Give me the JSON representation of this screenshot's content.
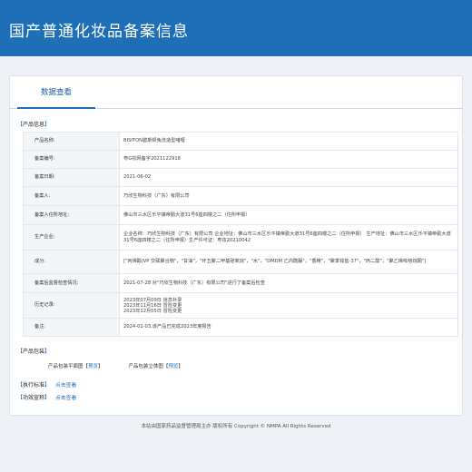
{
  "header": {
    "title": "国产普通化妆品备案信息"
  },
  "tabs": [
    {
      "label": "数据查看"
    }
  ],
  "product_info": {
    "section_title": "产品信息",
    "rows": [
      {
        "label": "产品名称:",
        "value": "BISITON碧斯顿兔洗造型啫喱"
      },
      {
        "label": "备案编号:",
        "value": "粤G妆网备字2021122918"
      },
      {
        "label": "备案日期:",
        "value": "2021-06-02"
      },
      {
        "label": "备案人:",
        "value": "巧欣生物科技（广东）有限公司"
      },
      {
        "label": "备案人住所地址:",
        "value": "佛山市三水区乐平镇帝勤大道31号6座四楼之二（住所申报）"
      },
      {
        "label": "生产企业:",
        "value": "企业名称：巧欣生物科技（广东）有限公司 企业地址：佛山市三水区乐平镇帝勤大道31号6座四楼之二（住所申报） 生产地址：佛山市三水区乐平镇帝勤大道31号6座四楼之二（住所申报）生产许可证：粤妆20210042"
      },
      {
        "label": "成分:",
        "value": "[\"丙烯酸/VP 交联聚合物\"，\"甘油\"，\"环五聚二甲基硅氧烷\"，\"水\"，\"DMDM 乙内酰脲\"，\"香精\"，\"聚季铵盐-37\"，\"丙二醇\"，\"聚乙烯吡咯烷酮\"]"
      },
      {
        "label": "备案后监督检查情况:",
        "value": "2021-07-28 对\"巧欣生物科技（广东）有限公司\"进行了备案后检查"
      },
      {
        "label": "历史记录:",
        "value": "2023年07月09日 信息补录\n2023年11月16日 冒险变更\n2023年12月05日 冒险变更"
      },
      {
        "label": "备注:",
        "value": "2024-01-03,该产品已完成2023年度报告"
      }
    ]
  },
  "packaging": {
    "section_title": "产品包装",
    "items": [
      {
        "name": "产品包装平面图",
        "link": "预览"
      },
      {
        "name": "产品包装立体图",
        "link": "预览"
      }
    ]
  },
  "standard": {
    "section_title": "执行标准",
    "link": "点击查看"
  },
  "efficacy": {
    "section_title": "功效宣称",
    "link": "点击查看"
  },
  "footer": {
    "text": "本站由国家药品监督管理局主办 版权所有 Copyright © NMPA All Rights Reserved"
  }
}
